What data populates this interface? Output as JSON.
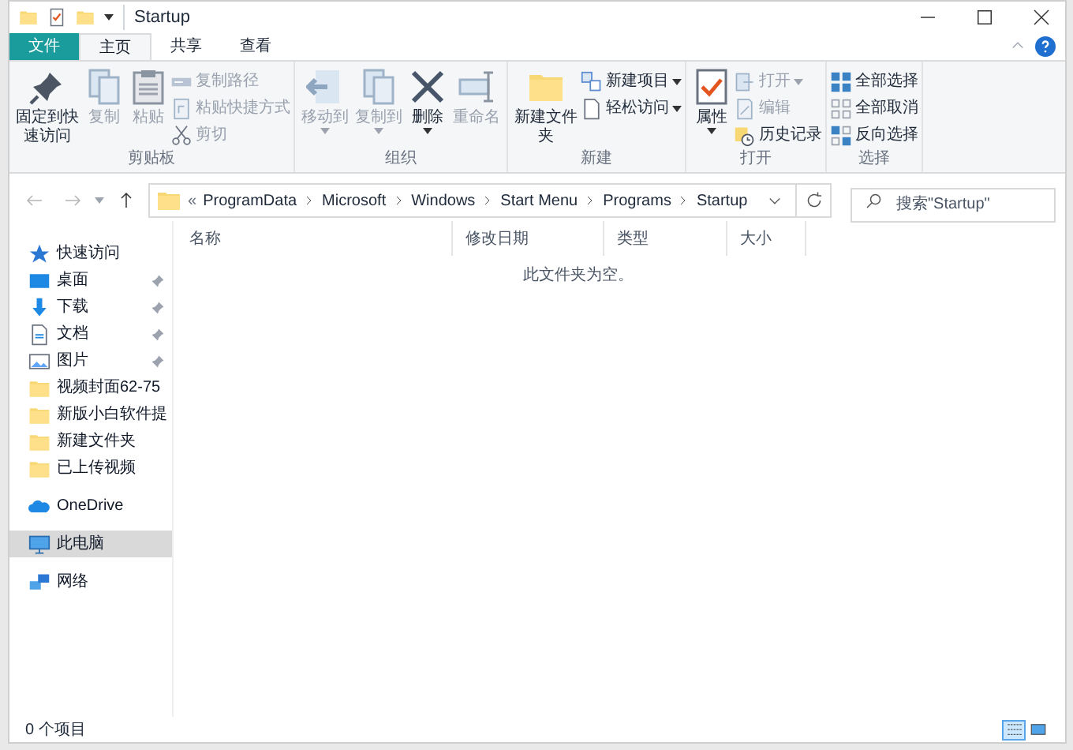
{
  "window": {
    "title": "Startup"
  },
  "ribbon_tabs": [
    {
      "label": "文件",
      "kind": "file",
      "selected": false
    },
    {
      "label": "主页",
      "kind": "tab",
      "selected": true
    },
    {
      "label": "共享",
      "kind": "tab",
      "selected": false
    },
    {
      "label": "查看",
      "kind": "tab",
      "selected": false
    }
  ],
  "ribbon_groups": [
    {
      "label": "剪贴板",
      "large": [
        {
          "label": "固定到快速访问",
          "kind": "pin",
          "disabled": false,
          "dropdown": false
        },
        {
          "label": "复制",
          "kind": "copy",
          "disabled": true,
          "dropdown": false
        },
        {
          "label": "粘贴",
          "kind": "paste",
          "disabled": true,
          "dropdown": false
        }
      ],
      "small": [
        {
          "label": "复制路径",
          "kind": "path",
          "disabled": true,
          "dropdown": false
        },
        {
          "label": "粘贴快捷方式",
          "kind": "shortcut",
          "disabled": true,
          "dropdown": false
        },
        {
          "label": "剪切",
          "kind": "cut",
          "disabled": true,
          "dropdown": false
        }
      ]
    },
    {
      "label": "组织",
      "large": [
        {
          "label": "移动到",
          "kind": "move",
          "disabled": true,
          "dropdown": true
        },
        {
          "label": "复制到",
          "kind": "copyto",
          "disabled": true,
          "dropdown": true
        },
        {
          "label": "删除",
          "kind": "delete",
          "disabled": false,
          "dropdown": true
        },
        {
          "label": "重命名",
          "kind": "rename",
          "disabled": true,
          "dropdown": false
        }
      ]
    },
    {
      "label": "新建",
      "large": [
        {
          "label": "新建文件夹",
          "kind": "folder",
          "disabled": false,
          "dropdown": false
        }
      ],
      "small": [
        {
          "label": "新建项目",
          "kind": "newitem",
          "disabled": false,
          "dropdown": true
        },
        {
          "label": "轻松访问",
          "kind": "easy",
          "disabled": false,
          "dropdown": true
        }
      ]
    },
    {
      "label": "打开",
      "large": [
        {
          "label": "属性",
          "kind": "props",
          "disabled": false,
          "dropdown": true
        }
      ],
      "small": [
        {
          "label": "打开",
          "kind": "open",
          "disabled": true,
          "dropdown": true
        },
        {
          "label": "编辑",
          "kind": "edit",
          "disabled": true,
          "dropdown": false
        },
        {
          "label": "历史记录",
          "kind": "history",
          "disabled": false,
          "dropdown": false
        }
      ]
    },
    {
      "label": "选择",
      "small": [
        {
          "label": "全部选择",
          "kind": "selall",
          "disabled": false,
          "dropdown": false
        },
        {
          "label": "全部取消",
          "kind": "selnone",
          "disabled": false,
          "dropdown": false
        },
        {
          "label": "反向选择",
          "kind": "selinv",
          "disabled": false,
          "dropdown": false
        }
      ]
    }
  ],
  "address": {
    "overflow": "«",
    "crumbs": [
      "ProgramData",
      "Microsoft",
      "Windows",
      "Start Menu",
      "Programs",
      "Startup"
    ]
  },
  "search": {
    "placeholder": "搜索\"Startup\""
  },
  "nav_pane": [
    {
      "label": "快速访问",
      "kind": "star",
      "pinned": false,
      "selected": false
    },
    {
      "label": "桌面",
      "kind": "desktop",
      "pinned": true,
      "selected": false
    },
    {
      "label": "下载",
      "kind": "download",
      "pinned": true,
      "selected": false
    },
    {
      "label": "文档",
      "kind": "document",
      "pinned": true,
      "selected": false
    },
    {
      "label": "图片",
      "kind": "pictures",
      "pinned": true,
      "selected": false
    },
    {
      "label": "视频封面62-75",
      "kind": "folder",
      "pinned": false,
      "selected": false
    },
    {
      "label": "新版小白软件提",
      "kind": "folder",
      "pinned": false,
      "selected": false
    },
    {
      "label": "新建文件夹",
      "kind": "folder",
      "pinned": false,
      "selected": false
    },
    {
      "label": "已上传视频",
      "kind": "folder",
      "pinned": false,
      "selected": false
    },
    {
      "label": "OneDrive",
      "kind": "cloud",
      "pinned": false,
      "selected": false
    },
    {
      "label": "此电脑",
      "kind": "pc",
      "pinned": false,
      "selected": true
    },
    {
      "label": "网络",
      "kind": "network",
      "pinned": false,
      "selected": false
    }
  ],
  "columns": [
    "名称",
    "修改日期",
    "类型",
    "大小"
  ],
  "empty_message": "此文件夹为空。",
  "status_bar": {
    "item_count": "0 个项目",
    "views": [
      {
        "kind": "details",
        "selected": true
      },
      {
        "kind": "thumbnails",
        "selected": false
      }
    ]
  }
}
